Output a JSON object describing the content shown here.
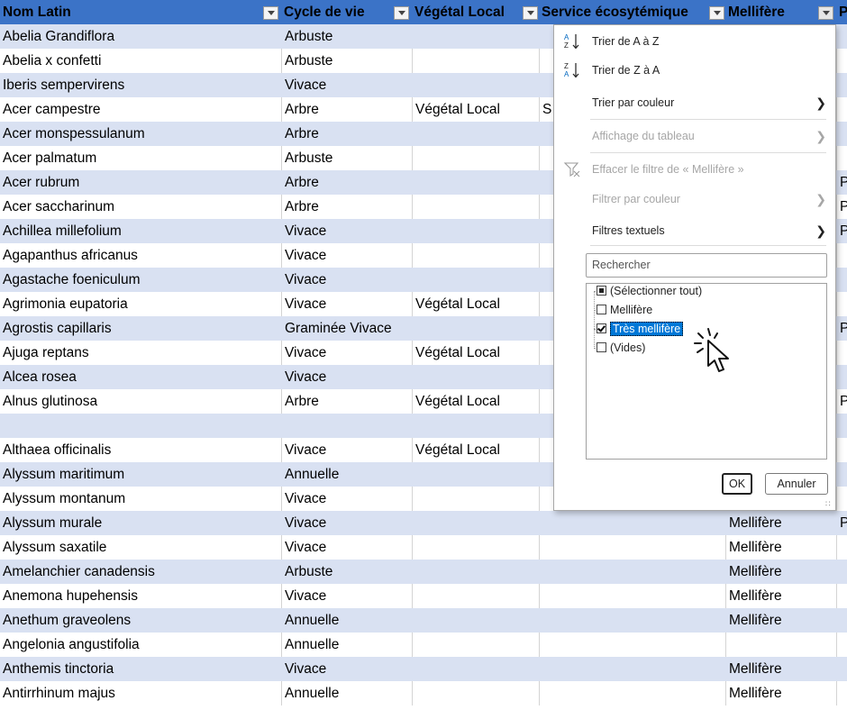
{
  "columns": [
    {
      "label": "Nom Latin"
    },
    {
      "label": "Cycle de vie"
    },
    {
      "label": "Végétal Local"
    },
    {
      "label": "Service écosytémique"
    },
    {
      "label": "Mellifère"
    },
    {
      "label": "P"
    }
  ],
  "rows": [
    {
      "name": "Abelia Grandiflora",
      "cycle": "Arbuste",
      "local": "",
      "service": "",
      "mellifere": "",
      "p": ""
    },
    {
      "name": "Abelia x confetti",
      "cycle": "Arbuste",
      "local": "",
      "service": "",
      "mellifere": "",
      "p": ""
    },
    {
      "name": "Iberis sempervirens",
      "cycle": "Vivace",
      "local": "",
      "service": "",
      "mellifere": "",
      "p": ""
    },
    {
      "name": "Acer campestre",
      "cycle": "Arbre",
      "local": "Végétal Local",
      "service": "S",
      "mellifere": "",
      "p": ""
    },
    {
      "name": "Acer monspessulanum",
      "cycle": "Arbre",
      "local": "",
      "service": "",
      "mellifere": "",
      "p": ""
    },
    {
      "name": "Acer palmatum",
      "cycle": "Arbuste",
      "local": "",
      "service": "",
      "mellifere": "",
      "p": ""
    },
    {
      "name": "Acer rubrum",
      "cycle": "Arbre",
      "local": "",
      "service": "",
      "mellifere": "",
      "p": "P"
    },
    {
      "name": "Acer saccharinum",
      "cycle": "Arbre",
      "local": "",
      "service": "",
      "mellifere": "",
      "p": "P"
    },
    {
      "name": "Achillea millefolium",
      "cycle": "Vivace",
      "local": "",
      "service": "",
      "mellifere": "",
      "p": "P"
    },
    {
      "name": "Agapanthus africanus",
      "cycle": "Vivace",
      "local": "",
      "service": "",
      "mellifere": "",
      "p": ""
    },
    {
      "name": "Agastache foeniculum",
      "cycle": "Vivace",
      "local": "",
      "service": "",
      "mellifere": "",
      "p": ""
    },
    {
      "name": "Agrimonia eupatoria",
      "cycle": "Vivace",
      "local": "Végétal Local",
      "service": "",
      "mellifere": "",
      "p": ""
    },
    {
      "name": "Agrostis capillaris",
      "cycle": "Graminée Vivace",
      "local": "",
      "service": "",
      "mellifere": "",
      "p": "P"
    },
    {
      "name": "Ajuga reptans",
      "cycle": "Vivace",
      "local": "Végétal Local",
      "service": "",
      "mellifere": "",
      "p": ""
    },
    {
      "name": "Alcea rosea",
      "cycle": "Vivace",
      "local": "",
      "service": "",
      "mellifere": "",
      "p": ""
    },
    {
      "name": "Alnus glutinosa",
      "cycle": "Arbre",
      "local": "Végétal Local",
      "service": "",
      "mellifere": "",
      "p": "P"
    },
    {
      "name": "",
      "cycle": "",
      "local": "",
      "service": "",
      "mellifere": "",
      "p": ""
    },
    {
      "name": "Althaea officinalis",
      "cycle": "Vivace",
      "local": "Végétal Local",
      "service": "",
      "mellifere": "",
      "p": ""
    },
    {
      "name": "Alyssum maritimum",
      "cycle": "Annuelle",
      "local": "",
      "service": "",
      "mellifere": "",
      "p": ""
    },
    {
      "name": "Alyssum montanum",
      "cycle": "Vivace",
      "local": "",
      "service": "",
      "mellifere": "",
      "p": ""
    },
    {
      "name": "Alyssum murale",
      "cycle": "Vivace",
      "local": "",
      "service": "",
      "mellifere": "Mellifère",
      "p": "P"
    },
    {
      "name": "Alyssum saxatile",
      "cycle": "Vivace",
      "local": "",
      "service": "",
      "mellifere": "Mellifère",
      "p": ""
    },
    {
      "name": "Amelanchier canadensis",
      "cycle": "Arbuste",
      "local": "",
      "service": "",
      "mellifere": "Mellifère",
      "p": ""
    },
    {
      "name": "Anemona hupehensis",
      "cycle": "Vivace",
      "local": "",
      "service": "",
      "mellifere": "Mellifère",
      "p": ""
    },
    {
      "name": "Anethum graveolens",
      "cycle": "Annuelle",
      "local": "",
      "service": "",
      "mellifere": "Mellifère",
      "p": ""
    },
    {
      "name": "Angelonia angustifolia",
      "cycle": "Annuelle",
      "local": "",
      "service": "",
      "mellifere": "",
      "p": ""
    },
    {
      "name": "Anthemis tinctoria",
      "cycle": "Vivace",
      "local": "",
      "service": "",
      "mellifere": "Mellifère",
      "p": ""
    },
    {
      "name": "Antirrhinum majus",
      "cycle": "Annuelle",
      "local": "",
      "service": "",
      "mellifere": "Mellifère",
      "p": ""
    }
  ],
  "menu": {
    "sort_az": "Trier de A à Z",
    "sort_za": "Trier de Z à A",
    "sort_color": "Trier par couleur",
    "table_view": "Affichage du tableau",
    "clear_filter": "Effacer le filtre de « Mellifère »",
    "filter_color": "Filtrer par couleur",
    "text_filters": "Filtres textuels",
    "search_placeholder": "Rechercher",
    "values": [
      {
        "label": "(Sélectionner tout)",
        "state": "partial"
      },
      {
        "label": "Mellifère",
        "state": "unchecked"
      },
      {
        "label": "Très mellifère",
        "state": "checked"
      },
      {
        "label": "(Vides)",
        "state": "unchecked"
      }
    ],
    "ok": "OK",
    "cancel": "Annuler"
  },
  "icons": {
    "sort_az": "sort-ascending-icon",
    "sort_za": "sort-descending-icon",
    "clear_filter": "funnel-clear-icon",
    "cursor": "pointer-hand-click-icon"
  },
  "colors": {
    "header": "#3B73C7",
    "band": "#D9E1F2",
    "selection": "#0078D7"
  }
}
